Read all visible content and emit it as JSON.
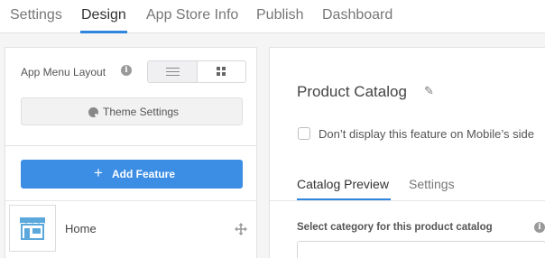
{
  "topnav": {
    "tabs": [
      {
        "label": "Settings"
      },
      {
        "label": "Design"
      },
      {
        "label": "App Store Info"
      },
      {
        "label": "Publish"
      },
      {
        "label": "Dashboard"
      }
    ],
    "active_tab": "Design"
  },
  "left": {
    "layout_label": "App Menu Layout",
    "layout_options": [
      "list-icon",
      "grid-icon"
    ],
    "selected_layout": "list-icon",
    "theme_button": "Theme Settings",
    "add_button": "Add Feature",
    "features": [
      {
        "label": "Home",
        "icon": "store-icon"
      }
    ]
  },
  "right": {
    "title": "Product Catalog",
    "checkbox_label": "Don’t display this feature on Mobile’s side",
    "checkbox_checked": false,
    "subtabs": [
      {
        "label": "Catalog Preview"
      },
      {
        "label": "Settings"
      }
    ],
    "active_subtab": "Catalog Preview",
    "select_label": "Select category for this product catalog"
  },
  "colors": {
    "accent": "#2f86de",
    "button": "#3c8ee5",
    "background": "#f5f5f6"
  }
}
